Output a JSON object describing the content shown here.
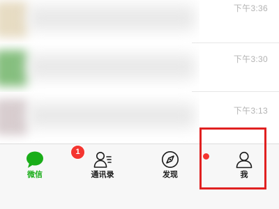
{
  "chat_list": {
    "rows": [
      {
        "time": "下午3:36"
      },
      {
        "time": "下午3:30"
      },
      {
        "time": "下午3:13"
      }
    ]
  },
  "tab_bar": {
    "active_tab": "微信",
    "tabs": [
      {
        "label": "微信",
        "icon": "chat-bubble-icon",
        "badge": "1"
      },
      {
        "label": "通讯录",
        "icon": "contacts-icon"
      },
      {
        "label": "发现",
        "icon": "compass-icon",
        "has_dot": true
      },
      {
        "label": "我",
        "icon": "person-icon"
      }
    ]
  },
  "colors": {
    "active_green": "#1aad19",
    "badge_red": "#f43530",
    "highlight_red": "#e02020",
    "tab_bar_bg": "#f7f7f7",
    "time_gray": "#b2b2b2"
  }
}
